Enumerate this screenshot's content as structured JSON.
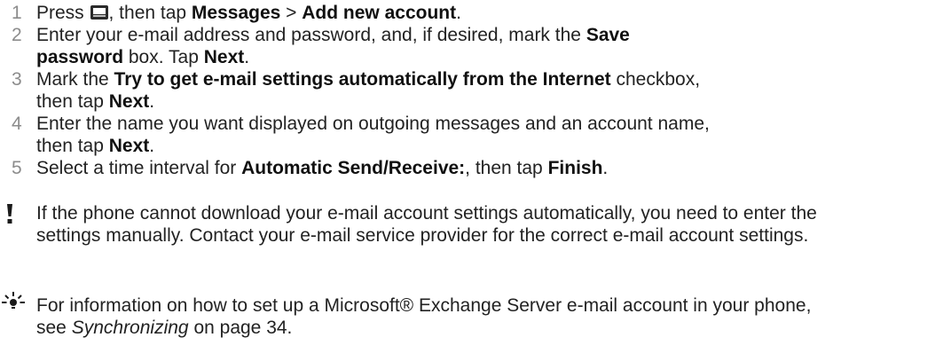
{
  "steps": [
    {
      "number": "1",
      "p1": "Press ",
      "p2": ", then tap ",
      "b1": "Messages",
      "p3": " > ",
      "b2": "Add new account",
      "p4": "."
    },
    {
      "number": "2",
      "p1": "Enter your e-mail address and password, and, if desired, mark the ",
      "b1": "Save",
      "b2": "password",
      "p2": " box. Tap ",
      "b3": "Next",
      "p3": "."
    },
    {
      "number": "3",
      "p1": "Mark the ",
      "b1": "Try to get e-mail settings automatically from the Internet",
      "p2": " checkbox,",
      "p3": "then tap ",
      "b2": "Next",
      "p4": "."
    },
    {
      "number": "4",
      "p1": "Enter the name you want displayed on outgoing messages and an account name,",
      "p2": "then tap ",
      "b1": "Next",
      "p3": "."
    },
    {
      "number": "5",
      "p1": "Select a time interval for ",
      "b1": "Automatic Send/Receive:",
      "p2": ", then tap ",
      "b2": "Finish",
      "p3": "."
    }
  ],
  "note": {
    "icon": "exclamation-icon",
    "line1": "If the phone cannot download your e-mail account settings automatically, you need to enter the",
    "line2": "settings manually. Contact your e-mail service provider for the correct e-mail account settings."
  },
  "tip": {
    "icon": "lightbulb-tip-icon",
    "line1": "For information on how to set up a Microsoft® Exchange Server e-mail account in your phone,",
    "p1": "see ",
    "ref": "Synchronizing",
    "p2": " on page 34."
  },
  "colors": {
    "text": "#222222",
    "step_number": "#8c8c8c"
  }
}
